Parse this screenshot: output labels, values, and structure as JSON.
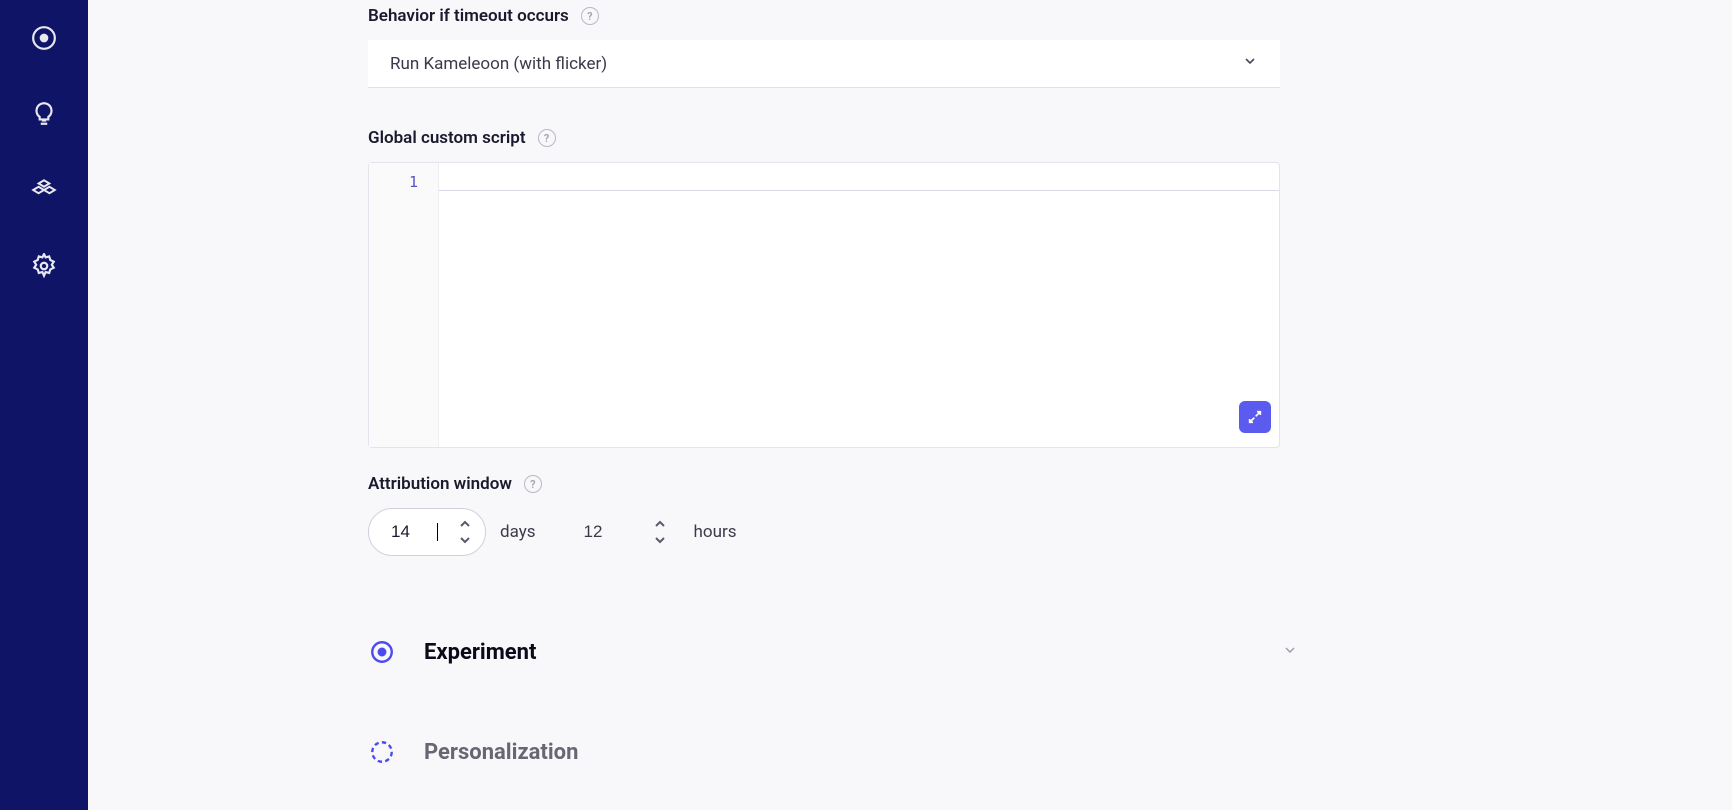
{
  "sidebar": {
    "items": [
      {
        "name": "target-icon"
      },
      {
        "name": "lightbulb-icon"
      },
      {
        "name": "cells-icon"
      },
      {
        "name": "gear-icon"
      }
    ]
  },
  "behavior": {
    "label": "Behavior if timeout occurs",
    "selected": "Run Kameleoon (with flicker)"
  },
  "script": {
    "label": "Global custom script",
    "line_number": "1"
  },
  "attribution": {
    "label": "Attribution window",
    "days_value": "14",
    "days_unit": "days",
    "hours_value": "12",
    "hours_unit": "hours"
  },
  "accordion": {
    "experiment_label": "Experiment",
    "personalization_label": "Personalization"
  }
}
